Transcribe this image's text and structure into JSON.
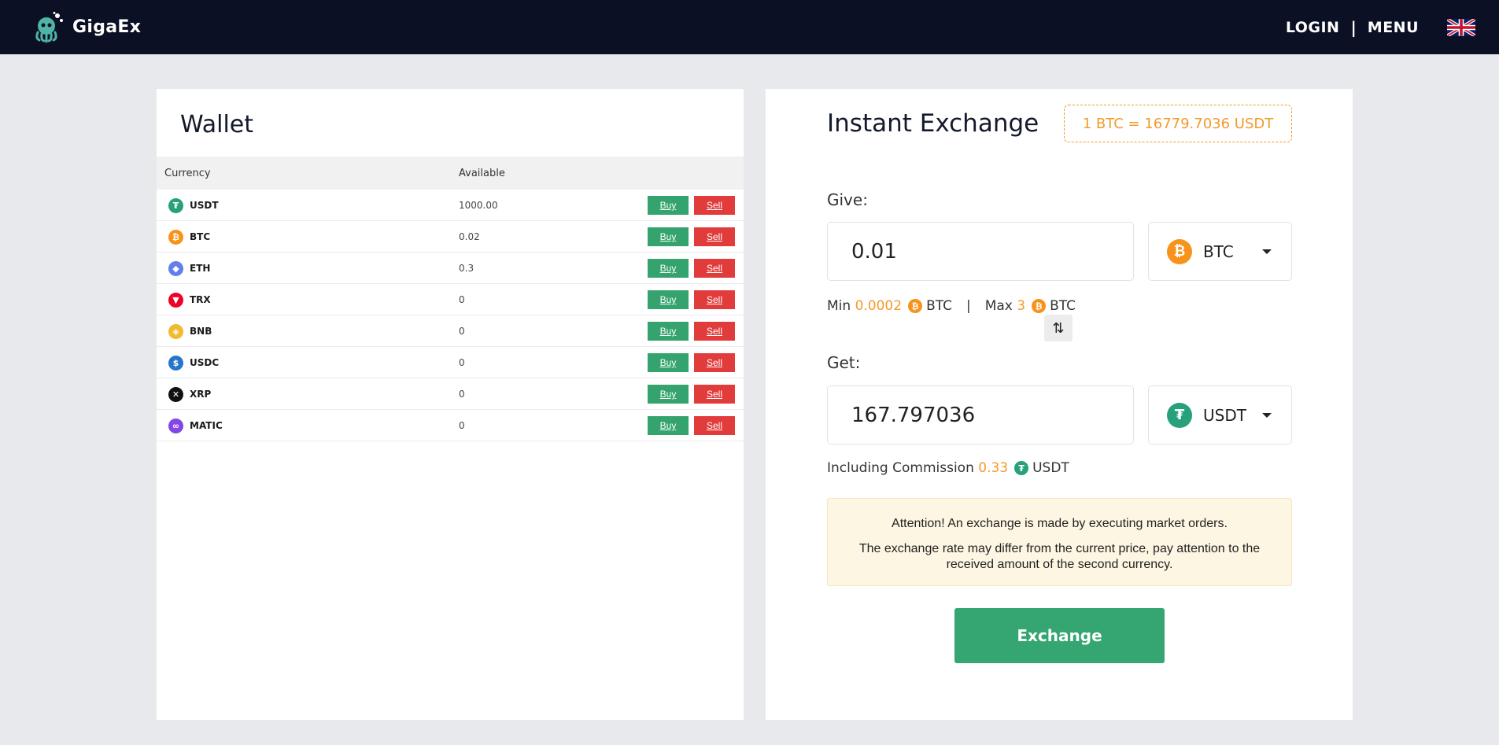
{
  "header": {
    "brand": "GigaEx",
    "login_label": "LOGIN",
    "separator": "|",
    "menu_label": "MENU",
    "language_icon": "uk-flag-icon"
  },
  "wallet": {
    "title": "Wallet",
    "columns": {
      "currency": "Currency",
      "available": "Available"
    },
    "buy_label": "Buy",
    "sell_label": "Sell",
    "rows": [
      {
        "symbol": "USDT",
        "amount": "1000.00",
        "icon": "tether-icon",
        "glyph": "₮",
        "color": "#26a17b"
      },
      {
        "symbol": "BTC",
        "amount": "0.02",
        "icon": "bitcoin-icon",
        "glyph": "₿",
        "color": "#f7931a"
      },
      {
        "symbol": "ETH",
        "amount": "0.3",
        "icon": "ethereum-icon",
        "glyph": "◆",
        "color": "#627eea"
      },
      {
        "symbol": "TRX",
        "amount": "0",
        "icon": "tron-icon",
        "glyph": "▼",
        "color": "#ef0027"
      },
      {
        "symbol": "BNB",
        "amount": "0",
        "icon": "bnb-icon",
        "glyph": "◈",
        "color": "#f3ba2f"
      },
      {
        "symbol": "USDC",
        "amount": "0",
        "icon": "usdc-icon",
        "glyph": "$",
        "color": "#2775ca"
      },
      {
        "symbol": "XRP",
        "amount": "0",
        "icon": "xrp-icon",
        "glyph": "✕",
        "color": "#111111"
      },
      {
        "symbol": "MATIC",
        "amount": "0",
        "icon": "polygon-icon",
        "glyph": "∞",
        "color": "#8247e5"
      }
    ]
  },
  "exchange": {
    "title": "Instant Exchange",
    "rate": "1 BTC = 16779.7036 USDT",
    "give_label": "Give:",
    "give_amount": "0.01",
    "give_currency": "BTC",
    "min_label": "Min",
    "min_value": "0.0002",
    "min_currency": "BTC",
    "limit_separator": "|",
    "max_label": "Max",
    "max_value": "3",
    "max_currency": "BTC",
    "get_label": "Get:",
    "get_amount": "167.797036",
    "get_currency": "USDT",
    "commission_label": "Including Commission",
    "commission_value": "0.33",
    "commission_currency": "USDT",
    "attention_line1": "Attention! An exchange is made by executing market orders.",
    "attention_line2": "The exchange rate may differ from the current price, pay attention to the received amount of the second currency.",
    "button_label": "Exchange"
  },
  "colors": {
    "header_bg": "#0b1024",
    "buy": "#34a36d",
    "sell": "#e23b3b",
    "accent_orange": "#f39a2c",
    "exchange_button": "#35a672",
    "btc": "#f7931a",
    "usdt": "#26a17b"
  }
}
